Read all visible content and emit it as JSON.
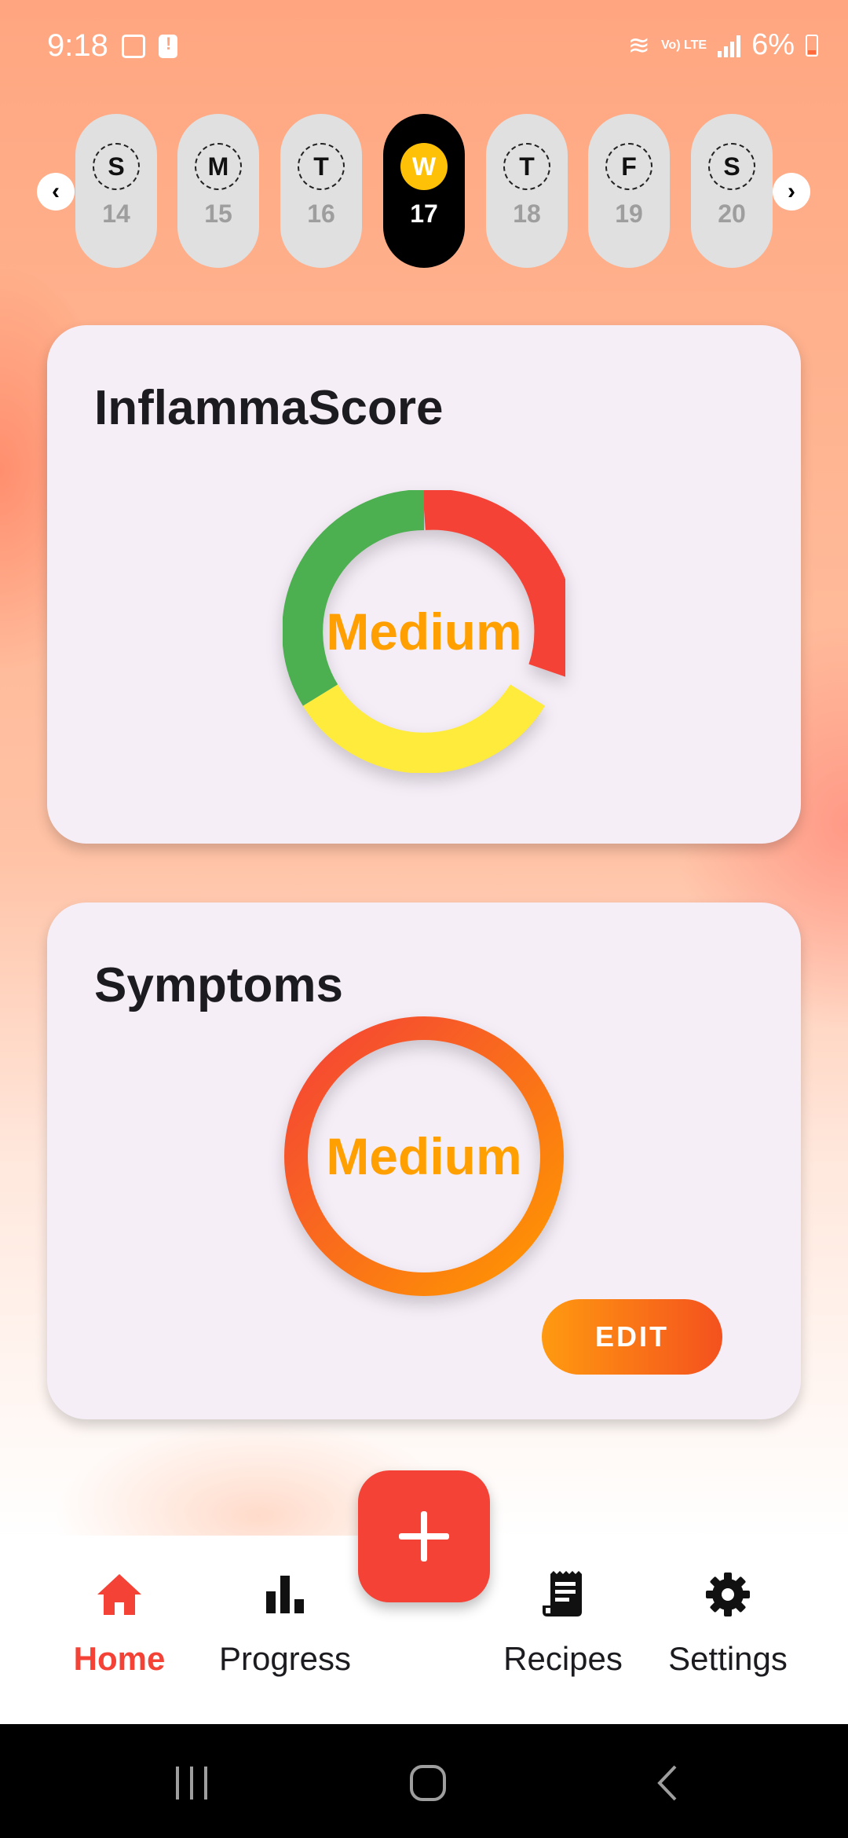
{
  "status_bar": {
    "time": "9:18",
    "network": "Vo) LTE",
    "battery": "6%",
    "icons": [
      "image-icon",
      "alert-icon",
      "wifi-icon",
      "signal-icon",
      "battery-icon"
    ]
  },
  "day_selector": {
    "days": [
      {
        "letter": "S",
        "num": "14",
        "active": false
      },
      {
        "letter": "M",
        "num": "15",
        "active": false
      },
      {
        "letter": "T",
        "num": "16",
        "active": false
      },
      {
        "letter": "W",
        "num": "17",
        "active": true
      },
      {
        "letter": "T",
        "num": "18",
        "active": false
      },
      {
        "letter": "F",
        "num": "19",
        "active": false
      },
      {
        "letter": "S",
        "num": "20",
        "active": false
      }
    ],
    "prev_icon": "chevron-left-icon",
    "next_icon": "chevron-right-icon"
  },
  "inflamma_card": {
    "title": "InflammaScore",
    "level": "Medium",
    "colors": {
      "green": "#4caf50",
      "red": "#f44336",
      "yellow": "#ffeb3b",
      "label": "#ff9f00"
    }
  },
  "symptoms_card": {
    "title": "Symptoms",
    "level": "Medium",
    "edit_label": "EDIT",
    "colors": {
      "ring_start": "#f4511e",
      "ring_end": "#ff9800",
      "label": "#ff9f00"
    }
  },
  "bottom_nav": {
    "items": [
      {
        "label": "Home",
        "icon": "home-icon",
        "active": true
      },
      {
        "label": "Progress",
        "icon": "bar-chart-icon",
        "active": false
      },
      {
        "label": "Recipes",
        "icon": "receipt-icon",
        "active": false
      },
      {
        "label": "Settings",
        "icon": "gear-icon",
        "active": false
      }
    ],
    "fab_icon": "plus-icon",
    "accent": "#f44336"
  },
  "system_nav": {
    "buttons": [
      "recents-icon",
      "home-circle-icon",
      "back-icon"
    ]
  }
}
